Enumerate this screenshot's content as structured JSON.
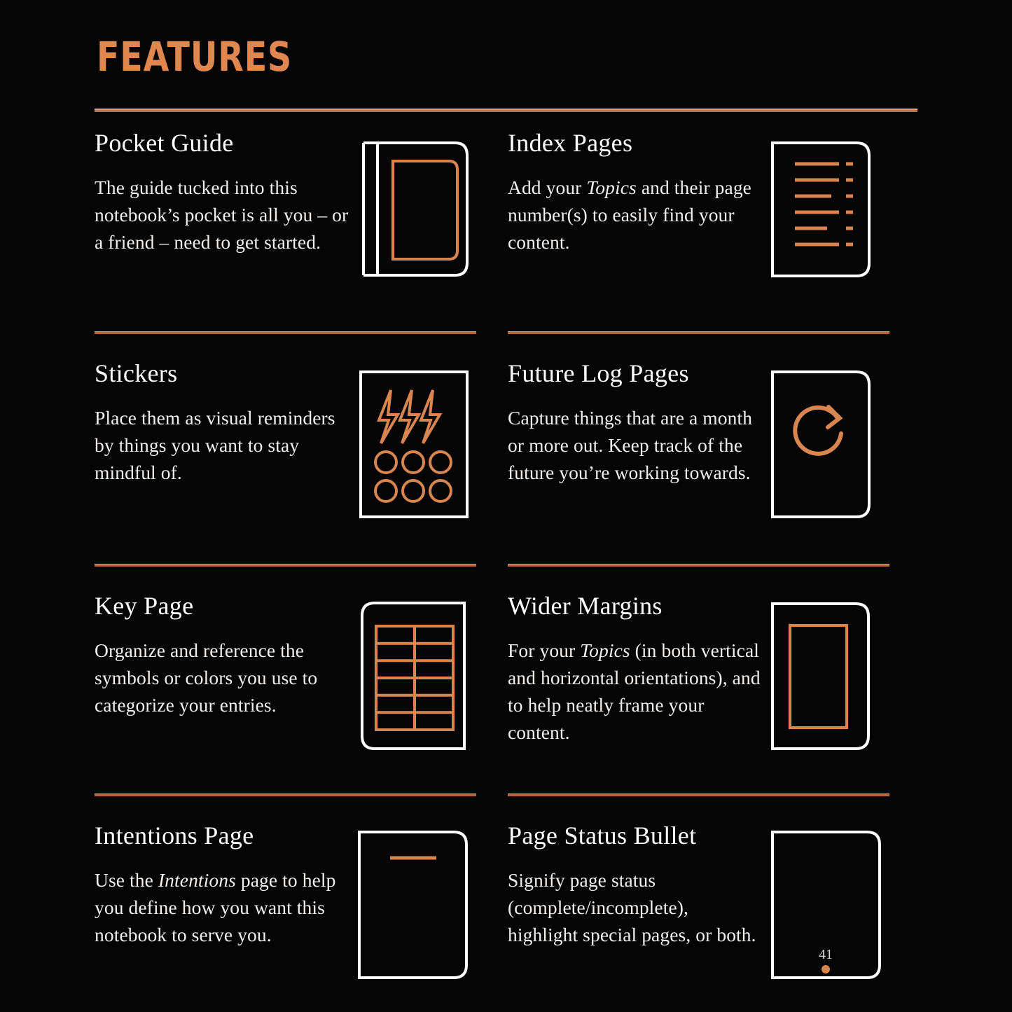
{
  "header": {
    "title": "FEATURES",
    "accent_color": "#d9854f",
    "rule_color": "#c2703f"
  },
  "theme": {
    "background": "#050505",
    "text_color": "#ffffff",
    "accent": "#d9854f",
    "outline": "#ffffff"
  },
  "features": [
    {
      "title": "Pocket Guide",
      "description": "The guide tucked into this notebook’s pocket is all you – or a friend – need to get started.",
      "icon": "notebook-with-pocket-icon"
    },
    {
      "title": "Index Pages",
      "description_parts": [
        "Add your ",
        "Topics",
        " and their page number(s) to easily find your content."
      ],
      "description": "Add your Topics and their page number(s) to easily find your content.",
      "icon": "index-lines-page-icon"
    },
    {
      "title": "Stickers",
      "description": "Place them as visual reminders by things you want to stay mindful of.",
      "icon": "sticker-sheet-icon"
    },
    {
      "title": "Future Log Pages",
      "description": "Capture things that are a month or more out. Keep track of the future you’re working towards.",
      "icon": "refresh-arrow-page-icon"
    },
    {
      "title": "Key Page",
      "description": "Organize and reference the symbols or colors you use to categorize your entries.",
      "icon": "key-table-page-icon"
    },
    {
      "title": "Wider Margins",
      "description_parts": [
        "For your ",
        "Topics",
        " (in both vertical and horizontal orientations), and to help neatly frame your content."
      ],
      "description": "For your Topics (in both vertical and horizontal orientations), and to help neatly frame your content.",
      "icon": "margin-frame-page-icon"
    },
    {
      "title": "Intentions Page",
      "description_parts": [
        "Use the ",
        "Intentions",
        " page to help you define how you want this notebook to serve you."
      ],
      "description": "Use the Intentions page to help you define how you want this notebook to serve you.",
      "icon": "intentions-line-page-icon"
    },
    {
      "title": "Page Status Bullet",
      "description": "Signify page status (complete/incomplete), highlight special pages, or both.",
      "icon": "page-status-bullet-icon",
      "icon_label": "41"
    }
  ]
}
